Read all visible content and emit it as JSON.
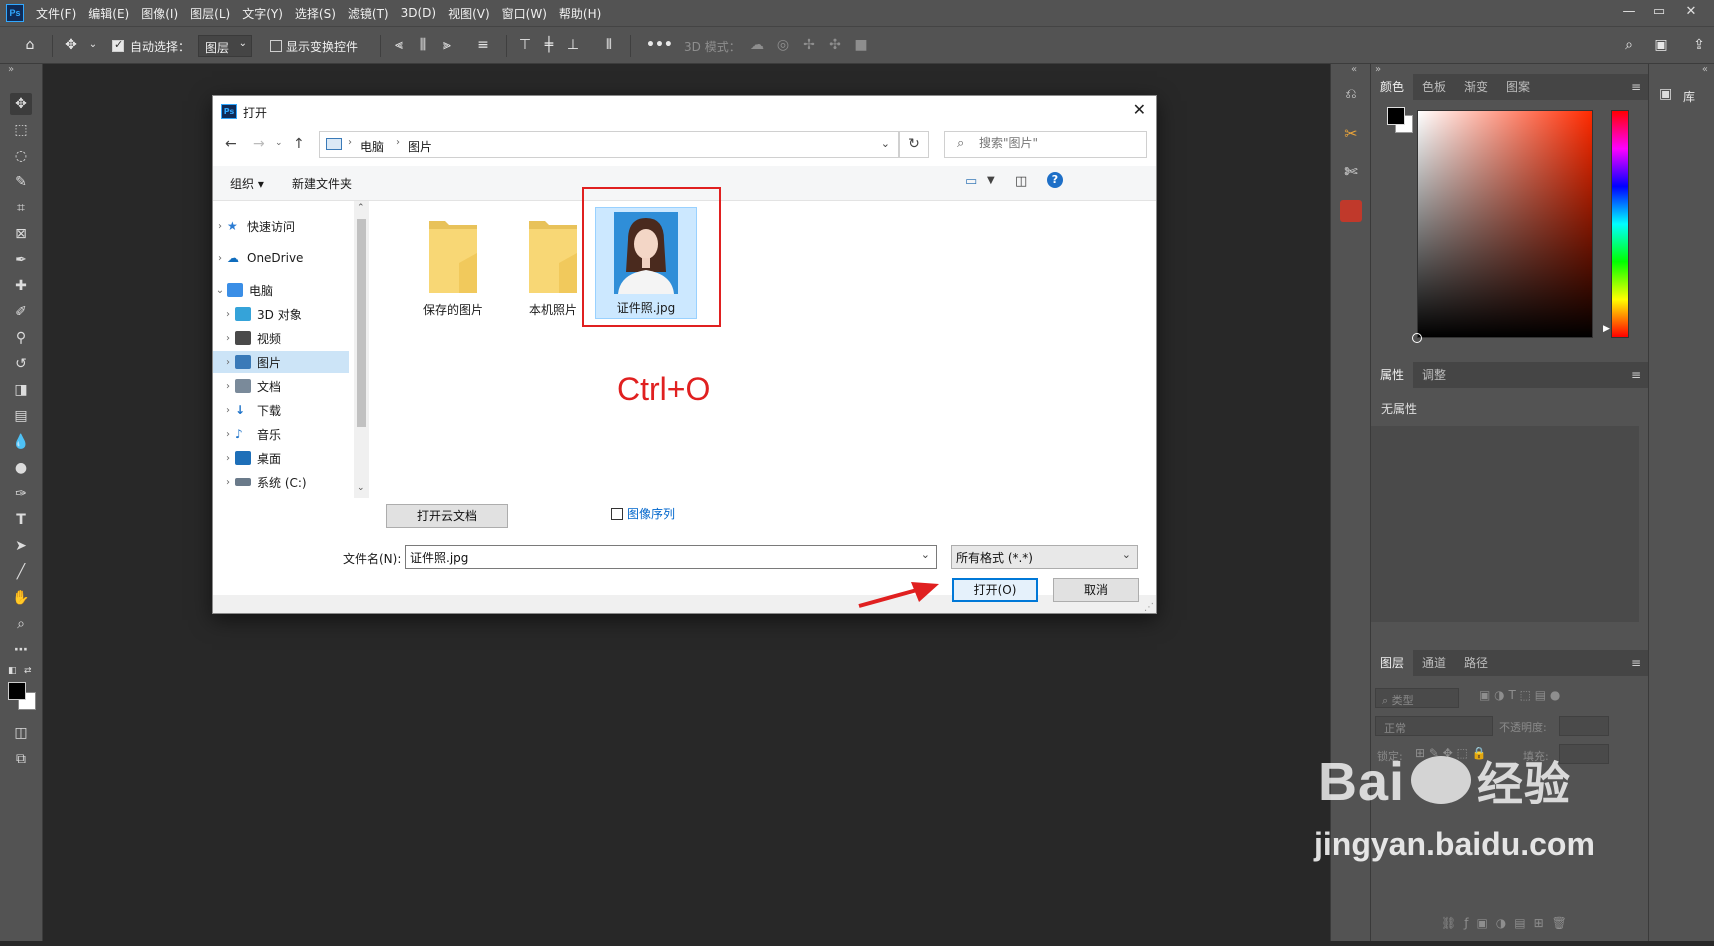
{
  "app": {
    "logo": "Ps",
    "menus": [
      "文件(F)",
      "编辑(E)",
      "图像(I)",
      "图层(L)",
      "文字(Y)",
      "选择(S)",
      "滤镜(T)",
      "3D(D)",
      "视图(V)",
      "窗口(W)",
      "帮助(H)"
    ]
  },
  "options": {
    "auto_select_label": "自动选择：",
    "auto_select_value": "图层",
    "show_transform_label": "显示变换控件",
    "more": "•••",
    "mode_3d_label": "3D 模式："
  },
  "panels": {
    "color_tabs": [
      "颜色",
      "色板",
      "渐变",
      "图案"
    ],
    "properties_tabs": [
      "属性",
      "调整"
    ],
    "properties_empty": "无属性",
    "layers_tabs": [
      "图层",
      "通道",
      "路径"
    ],
    "layers_filter": "类型",
    "blend_mode": "正常",
    "opacity_label": "不透明度:",
    "lock_label": "锁定:",
    "fill_label": "填充:",
    "library_label": "库"
  },
  "dialog": {
    "logo": "Ps",
    "title": "打开",
    "breadcrumb": [
      "电脑",
      "图片"
    ],
    "search_placeholder": "搜索\"图片\"",
    "organize": "组织 ▾",
    "new_folder": "新建文件夹",
    "tree": [
      {
        "label": "快速访问",
        "icon": "star-icon",
        "color": "#2b7cd3"
      },
      {
        "label": "OneDrive",
        "icon": "cloud-icon",
        "color": "#0f6cbd"
      },
      {
        "label": "电脑",
        "icon": "computer-icon",
        "color": "#3a8ee6"
      },
      {
        "label": "3D 对象",
        "icon": "cube-icon",
        "color": "#35a3d9"
      },
      {
        "label": "视频",
        "icon": "film-icon",
        "color": "#4a4a4a"
      },
      {
        "label": "图片",
        "icon": "picture-icon",
        "color": "#3a7ab8"
      },
      {
        "label": "文档",
        "icon": "document-icon",
        "color": "#7a8a9a"
      },
      {
        "label": "下载",
        "icon": "download-icon",
        "color": "#1e73c9"
      },
      {
        "label": "音乐",
        "icon": "music-icon",
        "color": "#1e73c9"
      },
      {
        "label": "桌面",
        "icon": "desktop-icon",
        "color": "#1e6fb8"
      },
      {
        "label": "系统 (C:)",
        "icon": "drive-icon",
        "color": "#6a7a8a"
      }
    ],
    "files": [
      "保存的图片",
      "本机照片",
      "证件照.jpg"
    ],
    "annotation": "Ctrl+O",
    "open_cloud": "打开云文档",
    "image_sequence": "图像序列",
    "filename_label": "文件名(N):",
    "filename_value": "证件照.jpg",
    "filetype": "所有格式 (*.*)",
    "open_button": "打开(O)",
    "cancel_button": "取消"
  },
  "watermark": {
    "brand": "Bai",
    "brand_cn": "经验",
    "url": "jingyan.baidu.com"
  },
  "colors": {
    "ps_chrome": "#535353",
    "canvas": "#282828",
    "highlight_red": "#e02020",
    "selection_blue": "#cce8ff"
  }
}
